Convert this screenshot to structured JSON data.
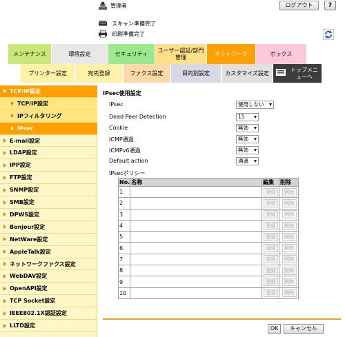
{
  "header": {
    "user": "管理者",
    "logout": "ログアウト",
    "help": "?",
    "scan_status": "スキャン準備完了",
    "print_status": "印刷準備完了"
  },
  "tabs_top": [
    {
      "label": "メンテナンス",
      "color": "#c8e878"
    },
    {
      "label": "環境設定",
      "color": "#e8e8e8"
    },
    {
      "label": "セキュリティ",
      "color": "#9ce88c"
    },
    {
      "label": "ユーザー認証/部門管理",
      "color": "#ffe088"
    },
    {
      "label": "ネットワーク",
      "color": "#ff9f00"
    },
    {
      "label": "ボックス",
      "color": "#ffc8d8"
    }
  ],
  "tabs_second": [
    {
      "label": "プリンター設定",
      "color": "#fff2a8"
    },
    {
      "label": "宛先登録",
      "color": "#fff2a8"
    },
    {
      "label": "ファクス設定",
      "color": "#ffd8a8"
    },
    {
      "label": "目的別設定",
      "color": "#d8d8e8"
    },
    {
      "label": "カスタマイズ設定",
      "color": "#e0e0e0"
    },
    {
      "label": "トップメニューへ",
      "color": "#3c3c3c"
    }
  ],
  "sidebar": {
    "items": [
      {
        "label": "TCP/IP設定",
        "level": 0,
        "active": true
      },
      {
        "label": "TCP/IP設定",
        "level": 1,
        "active": false
      },
      {
        "label": "IPフィルタリング",
        "level": 1,
        "active": false
      },
      {
        "label": "IPsec",
        "level": 1,
        "active": true
      },
      {
        "label": "E-mail設定",
        "level": 0,
        "active": false
      },
      {
        "label": "LDAP設定",
        "level": 0,
        "active": false
      },
      {
        "label": "IPP設定",
        "level": 0,
        "active": false
      },
      {
        "label": "FTP設定",
        "level": 0,
        "active": false
      },
      {
        "label": "SNMP設定",
        "level": 0,
        "active": false
      },
      {
        "label": "SMB設定",
        "level": 0,
        "active": false
      },
      {
        "label": "DPWS設定",
        "level": 0,
        "active": false
      },
      {
        "label": "Bonjour設定",
        "level": 0,
        "active": false
      },
      {
        "label": "NetWare設定",
        "level": 0,
        "active": false
      },
      {
        "label": "AppleTalk設定",
        "level": 0,
        "active": false
      },
      {
        "label": "ネットワークファクス設定",
        "level": 0,
        "active": false
      },
      {
        "label": "WebDAV設定",
        "level": 0,
        "active": false
      },
      {
        "label": "OpenAPI設定",
        "level": 0,
        "active": false
      },
      {
        "label": "TCP Socket設定",
        "level": 0,
        "active": false
      },
      {
        "label": "IEEE802.1X認証設定",
        "level": 0,
        "active": false
      },
      {
        "label": "LLTD設定",
        "level": 0,
        "active": false
      }
    ]
  },
  "main": {
    "title": "IPsec使用設定",
    "fields": [
      {
        "label": "IPsec",
        "value": "使用しない"
      },
      {
        "label": "Dead Peer Detection",
        "value": "15"
      },
      {
        "label": "Cookie",
        "value": "無効"
      },
      {
        "label": "ICMP通過",
        "value": "無効"
      },
      {
        "label": "ICMPv6通過",
        "value": "無効"
      },
      {
        "label": "Default action",
        "value": "通過"
      }
    ],
    "policy_title": "IPsecポリシー",
    "table": {
      "headers": [
        "No.",
        "名称",
        "編集",
        "削除"
      ],
      "rows": [
        "1",
        "2",
        "3",
        "4",
        "5",
        "6",
        "7",
        "8",
        "9",
        "10"
      ],
      "edit_label": "登録",
      "delete_label": "削除"
    },
    "ok": "OK",
    "cancel": "キャンセル"
  }
}
